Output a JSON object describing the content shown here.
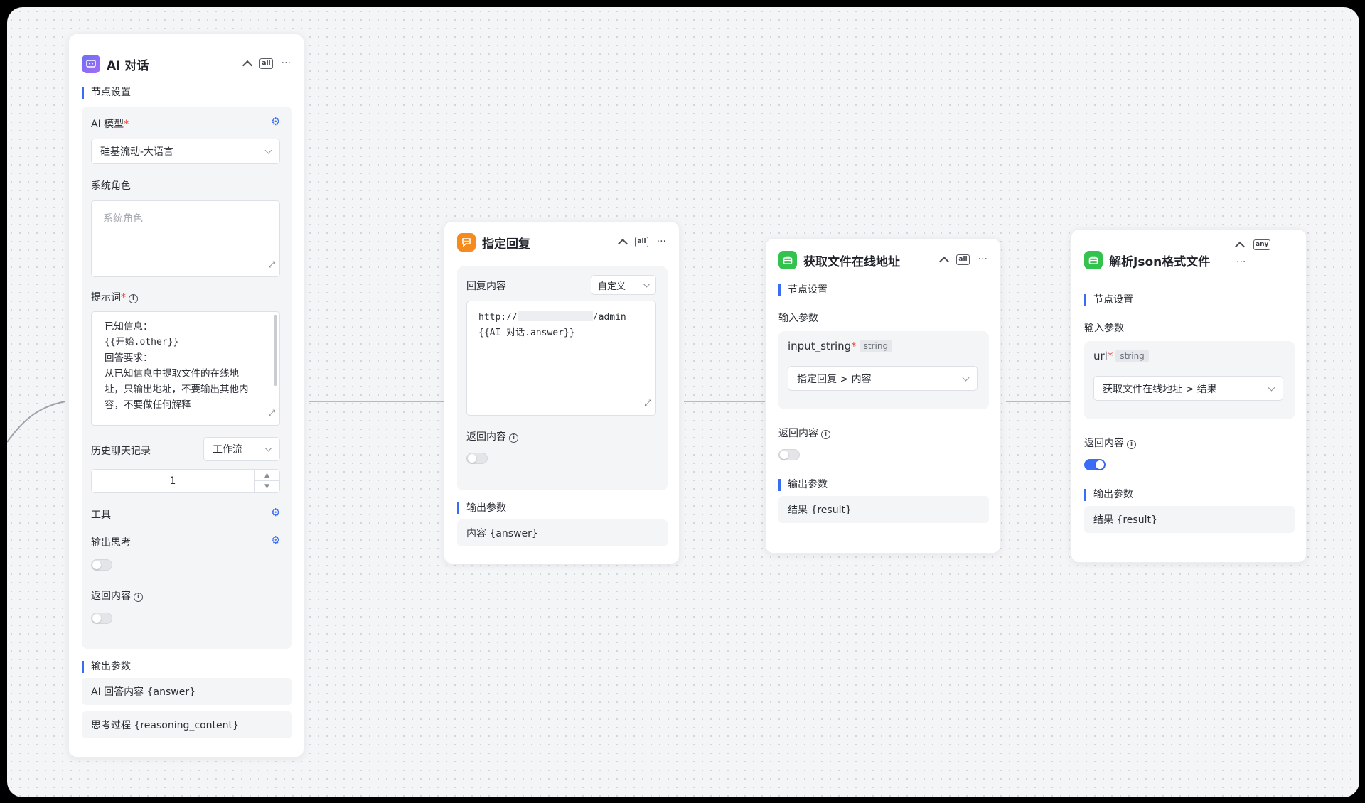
{
  "colors": {
    "accent": "#3b6cf6",
    "required": "#f0453a",
    "canvas": "#f4f5f7"
  },
  "nodes": {
    "ai_chat": {
      "icon": "chat-bot-icon",
      "title": "AI 对话",
      "tool_badge": "all",
      "section_settings": "节点设置",
      "model_label": "AI 模型",
      "model_value": "硅基流动-大语言",
      "system_role_label": "系统角色",
      "system_role_placeholder": "系统角色",
      "prompt_label": "提示词",
      "prompt_lines": [
        "已知信息：",
        "{{开始.other}}",
        "回答要求：",
        "从已知信息中提取文件的在线地",
        "址，只输出地址，不要输出其他内",
        "容，不要做任何解释"
      ],
      "history_label": "历史聊天记录",
      "history_select": "工作流",
      "history_count": "1",
      "tools_label": "工具",
      "thinking_label": "输出思考",
      "thinking_enabled": false,
      "return_label": "返回内容",
      "return_enabled": false,
      "section_output": "输出参数",
      "outputs": [
        "AI 回答内容 {answer}",
        "思考过程 {reasoning_content}"
      ]
    },
    "reply": {
      "icon": "reply-icon",
      "title": "指定回复",
      "tool_badge": "all",
      "reply_label": "回复内容",
      "reply_mode": "自定义",
      "reply_line1_prefix": "http://",
      "reply_line1_suffix": "/admin",
      "reply_line2": "{{AI 对话.answer}}",
      "return_label": "返回内容",
      "return_enabled": false,
      "section_output": "输出参数",
      "outputs": [
        "内容 {answer}"
      ]
    },
    "get_url": {
      "icon": "toolbox-icon",
      "title": "获取文件在线地址",
      "tool_badge": "all",
      "section_settings": "节点设置",
      "input_label": "输入参数",
      "param_name": "input_string",
      "param_type": "string",
      "param_value": "指定回复 > 内容",
      "return_label": "返回内容",
      "return_enabled": false,
      "section_output": "输出参数",
      "outputs": [
        "结果 {result}"
      ]
    },
    "parse_json": {
      "icon": "toolbox-icon",
      "title": "解析Json格式文件",
      "tool_badge": "any",
      "section_settings": "节点设置",
      "input_label": "输入参数",
      "param_name": "url",
      "param_type": "string",
      "param_value": "获取文件在线地址 > 结果",
      "return_label": "返回内容",
      "return_enabled": true,
      "section_output": "输出参数",
      "outputs": [
        "结果 {result}"
      ]
    }
  }
}
